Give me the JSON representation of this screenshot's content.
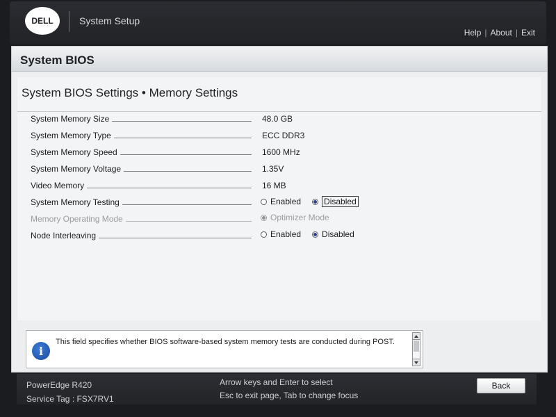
{
  "header": {
    "logo_text": "DELL",
    "app_title": "System Setup",
    "links": [
      "Help",
      "About",
      "Exit"
    ]
  },
  "section": {
    "title": "System BIOS"
  },
  "page": {
    "title": "System BIOS Settings • Memory Settings",
    "rows": [
      {
        "label": "System Memory Size",
        "value": "48.0 GB"
      },
      {
        "label": "System Memory Type",
        "value": "ECC DDR3"
      },
      {
        "label": "System Memory Speed",
        "value": "1600 MHz"
      },
      {
        "label": "System Memory Voltage",
        "value": "1.35V"
      },
      {
        "label": "Video Memory",
        "value": "16 MB"
      },
      {
        "label": "System Memory Testing",
        "options": [
          "Enabled",
          "Disabled"
        ],
        "selected": "Disabled"
      },
      {
        "label": "Memory Operating Mode",
        "options": [
          "Optimizer Mode"
        ],
        "selected": "Optimizer Mode",
        "disabled": true
      },
      {
        "label": "Node Interleaving",
        "options": [
          "Enabled",
          "Disabled"
        ],
        "selected": "Disabled"
      }
    ]
  },
  "help": {
    "text": "This field specifies whether BIOS software-based system memory tests are conducted during POST."
  },
  "footer": {
    "model": "PowerEdge R420",
    "service_tag": "Service Tag : FSX7RV1",
    "hint1": "Arrow keys and Enter to select",
    "hint2": "Esc to exit page, Tab to change focus",
    "back_label": "Back"
  },
  "colors": {
    "accent": "#2c3f8a",
    "panel": "#eceeef",
    "header_dark": "#2b2c31"
  }
}
